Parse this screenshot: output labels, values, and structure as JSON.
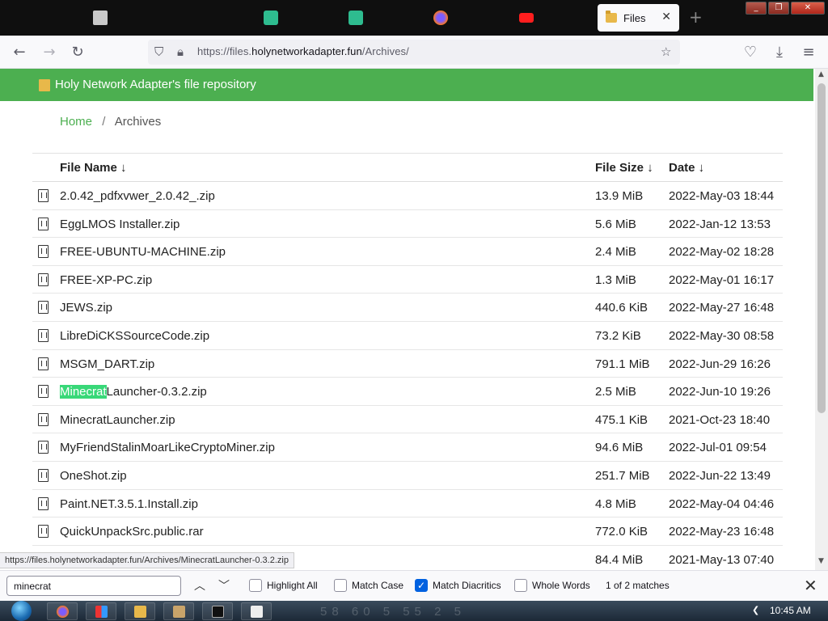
{
  "browser": {
    "active_tab_label": "Files",
    "tab_close": "✕",
    "new_tab": "+",
    "url_prefix": "https://files.",
    "url_host": "holynetworkadapter.fun",
    "url_path": "/Archives/",
    "status_url": "https://files.holynetworkadapter.fun/Archives/MinecratLauncher-0.3.2.zip"
  },
  "page": {
    "header_title": "Holy Network Adapter's file repository",
    "breadcrumb": {
      "home": "Home",
      "separator": "/",
      "current": "Archives"
    },
    "columns": {
      "name": "File Name  ↓",
      "size": "File Size  ↓",
      "date": "Date  ↓"
    },
    "files": [
      {
        "name": "2.0.42_pdfxvwer_2.0.42_.zip",
        "size": "13.9 MiB",
        "date": "2022-May-03 18:44"
      },
      {
        "name": "EggLMOS Installer.zip",
        "size": "5.6 MiB",
        "date": "2022-Jan-12 13:53"
      },
      {
        "name": "FREE-UBUNTU-MACHINE.zip",
        "size": "2.4 MiB",
        "date": "2022-May-02 18:28"
      },
      {
        "name": "FREE-XP-PC.zip",
        "size": "1.3 MiB",
        "date": "2022-May-01 16:17"
      },
      {
        "name": "JEWS.zip",
        "size": "440.6 KiB",
        "date": "2022-May-27 16:48"
      },
      {
        "name": "LibreDiCKSSourceCode.zip",
        "size": "73.2 KiB",
        "date": "2022-May-30 08:58"
      },
      {
        "name": "MSGM_DART.zip",
        "size": "791.1 MiB",
        "date": "2022-Jun-29 16:26"
      },
      {
        "name_highlight": "Minecrat",
        "name_rest": "Launcher-0.3.2.zip",
        "size": "2.5 MiB",
        "date": "2022-Jun-10 19:26"
      },
      {
        "name": "MinecratLauncher.zip",
        "size": "475.1 KiB",
        "date": "2021-Oct-23 18:40"
      },
      {
        "name": "MyFriendStalinMoarLikeCryptoMiner.zip",
        "size": "94.6 MiB",
        "date": "2022-Jul-01 09:54"
      },
      {
        "name": "OneShot.zip",
        "size": "251.7 MiB",
        "date": "2022-Jun-22 13:49"
      },
      {
        "name": "Paint.NET.3.5.1.Install.zip",
        "size": "4.8 MiB",
        "date": "2022-May-04 04:46"
      },
      {
        "name": "QuickUnpackSrc.public.rar",
        "size": "772.0 KiB",
        "date": "2022-May-23 16:48"
      },
      {
        "name": "",
        "size": "84.4 MiB",
        "date": "2021-May-13 07:40"
      }
    ]
  },
  "findbar": {
    "query": "minecrat",
    "highlight_all": "Highlight All",
    "match_case": "Match Case",
    "match_diacritics": "Match Diacritics",
    "whole_words": "Whole Words",
    "match_count": "1 of 2 matches",
    "match_diacritics_checked": true
  },
  "taskbar": {
    "clock": "10:45 AM",
    "ghost_text": "58 60 5 55 2 5"
  },
  "colors": {
    "header_green": "#4caf50",
    "highlight_green": "#38d878",
    "checkbox_blue": "#0061e0"
  }
}
